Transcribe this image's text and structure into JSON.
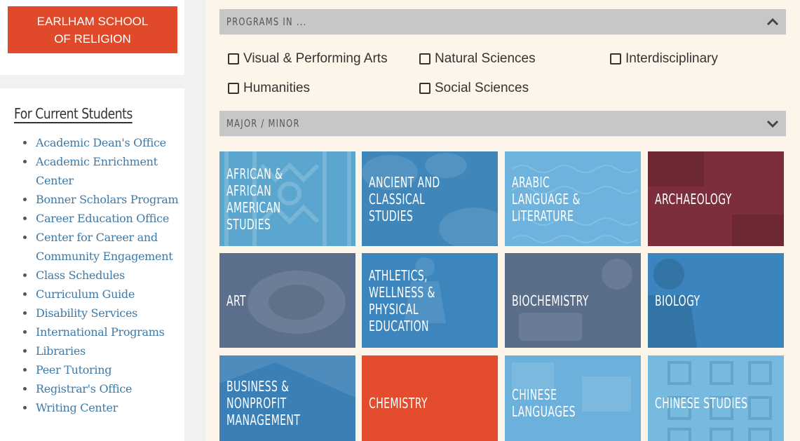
{
  "brand": {
    "line1": "EARLHAM SCHOOL",
    "line2": "OF RELIGION"
  },
  "nav": {
    "title": "For Current Students",
    "items": [
      "Academic Dean's Office",
      "Academic Enrichment Center",
      "Bonner Scholars Program",
      "Career Education Office",
      "Center for Career and Community Engagement",
      "Class Schedules",
      "Curriculum Guide",
      "Disability Services",
      "International Programs",
      "Libraries",
      "Peer Tutoring",
      "Registrar's Office",
      "Writing Center"
    ]
  },
  "programs_panel": {
    "label": "PROGRAMS IN ...",
    "expanded": true,
    "filters": [
      "Visual & Performing Arts",
      "Natural Sciences",
      "Interdisciplinary",
      "Humanities",
      "Social Sciences"
    ]
  },
  "major_panel": {
    "label": "MAJOR / MINOR",
    "expanded": false
  },
  "tiles": [
    {
      "label": "AFRICAN & AFRICAN AMERICAN STUDIES",
      "color": "#5aa6cf"
    },
    {
      "label": "ANCIENT AND CLASSICAL STUDIES",
      "color": "#3f87bb"
    },
    {
      "label": "ARABIC LANGUAGE & LITERATURE",
      "color": "#6db3dd"
    },
    {
      "label": "ARCHAEOLOGY",
      "color": "#7d2e3c"
    },
    {
      "label": "ART",
      "color": "#5b6f8c"
    },
    {
      "label": "ATHLETICS, WELLNESS & PHYSICAL EDUCATION",
      "color": "#3c86bd"
    },
    {
      "label": "BIOCHEMISTRY",
      "color": "#5a6e8a"
    },
    {
      "label": "BIOLOGY",
      "color": "#3b84bd"
    },
    {
      "label": "BUSINESS & NONPROFIT MANAGEMENT",
      "color": "#3a7fb6"
    },
    {
      "label": "CHEMISTRY",
      "color": "#e34c2c"
    },
    {
      "label": "CHINESE LANGUAGES",
      "color": "#6cb1dc"
    },
    {
      "label": "CHINESE STUDIES",
      "color": "#77badf"
    }
  ]
}
